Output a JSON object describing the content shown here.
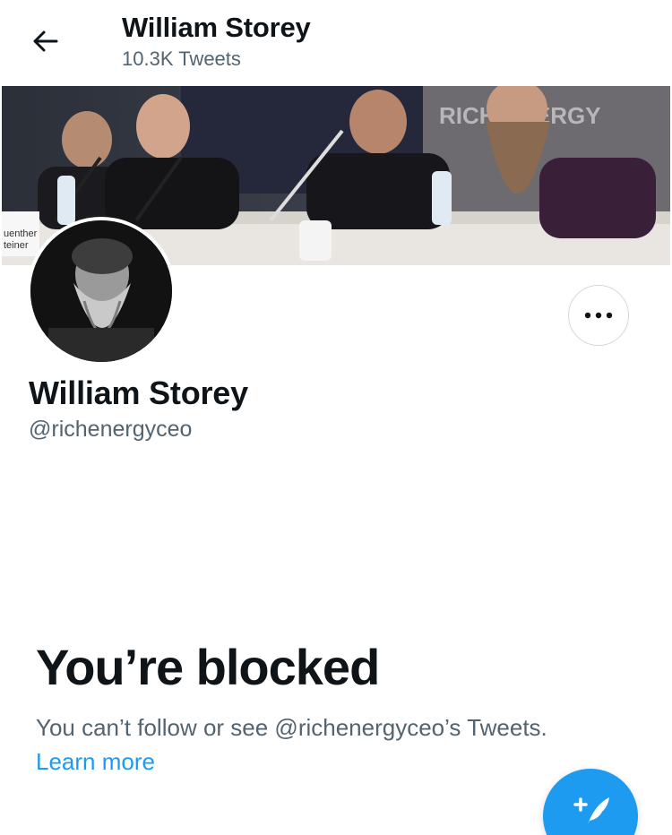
{
  "header": {
    "name": "William Storey",
    "tweet_count": "10.3K Tweets",
    "back_icon": "arrow-left-icon"
  },
  "banner": {
    "visible_text": [
      "RICH ENERGY",
      "uenther",
      "teiner"
    ]
  },
  "profile": {
    "name": "William Storey",
    "handle": "@richenergyceo",
    "more_icon": "ellipsis-icon"
  },
  "blocked": {
    "title": "You’re blocked",
    "message": "You can’t follow or see @richenergyceo’s Tweets.",
    "learn_more": "Learn more"
  },
  "fab": {
    "icon": "compose-tweet-icon"
  },
  "colors": {
    "accent": "#1d9bf0",
    "text_primary": "#0f1419",
    "text_secondary": "#536471",
    "border": "#cfd9de"
  }
}
